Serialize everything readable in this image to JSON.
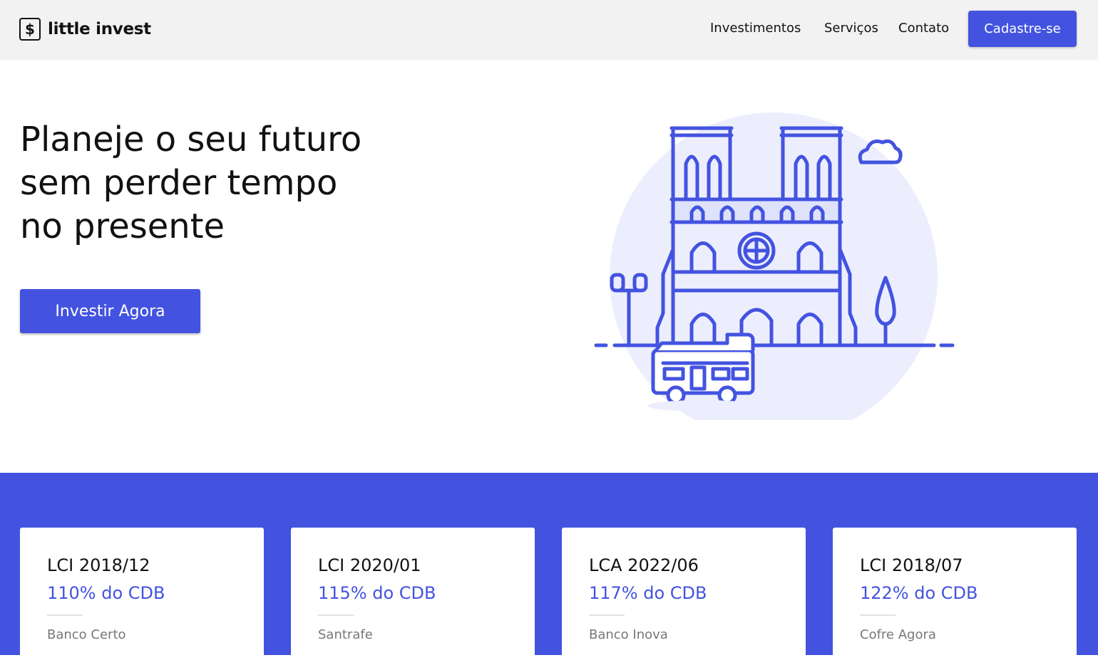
{
  "header": {
    "logo_symbol": "$",
    "logo_text": "little invest",
    "nav": [
      "Investimentos",
      "Serviços",
      "Contato"
    ],
    "signup_label": "Cadastre-se"
  },
  "hero": {
    "title_lines": [
      "Planeje o seu futuro",
      "sem perder tempo",
      "no presente"
    ],
    "cta_label": "Investir Agora",
    "illustration_icon": "cathedral-and-bus-illustration"
  },
  "colors": {
    "accent": "#4353e0",
    "header_bg": "#f2f2f2",
    "illustration_bg": "#eceefd",
    "text": "#111111",
    "muted": "#777777"
  },
  "investments": [
    {
      "title": "LCI 2018/12",
      "rate": "110% do CDB",
      "bank": "Banco Certo"
    },
    {
      "title": "LCI 2020/01",
      "rate": "115% do CDB",
      "bank": "Santrafe"
    },
    {
      "title": "LCA 2022/06",
      "rate": "117% do CDB",
      "bank": "Banco Inova"
    },
    {
      "title": "LCI 2018/07",
      "rate": "122% do CDB",
      "bank": "Cofre Agora"
    }
  ]
}
